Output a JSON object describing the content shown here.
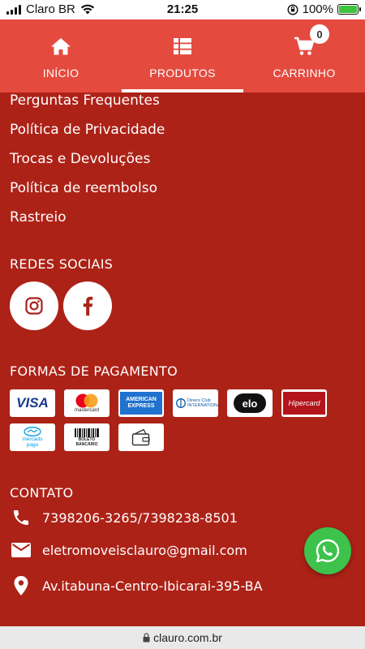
{
  "status_bar": {
    "carrier": "Claro BR",
    "time": "21:25",
    "battery": "100%",
    "battery_level": 1.0
  },
  "nav": {
    "tabs": [
      {
        "label": "INÍCIO",
        "icon": "home-icon",
        "active": false
      },
      {
        "label": "PRODUTOS",
        "icon": "list-icon",
        "active": true
      },
      {
        "label": "CARRINHO",
        "icon": "cart-icon",
        "active": false
      }
    ],
    "cart_count": "0"
  },
  "links": [
    "Perguntas Frequentes",
    "Política de Privacidade",
    "Trocas e Devoluções",
    "Política de reembolso",
    "Rastreio"
  ],
  "social": {
    "title": "REDES SOCIAIS",
    "items": [
      {
        "icon": "instagram-icon"
      },
      {
        "icon": "facebook-icon"
      }
    ]
  },
  "payments": {
    "title": "FORMAS DE PAGAMENTO",
    "items": [
      {
        "label": "VISA",
        "icon": "visa-icon"
      },
      {
        "label": "mastercard",
        "icon": "mastercard-icon"
      },
      {
        "label": "AMERICAN EXPRESS",
        "icon": "amex-icon"
      },
      {
        "label": "Diners Club INTERNATIONAL",
        "icon": "diners-icon"
      },
      {
        "label": "elo",
        "icon": "elo-icon"
      },
      {
        "label": "Hipercard",
        "icon": "hipercard-icon"
      },
      {
        "label": "mercado pago",
        "icon": "mercadopago-icon"
      },
      {
        "label": "BOLETO BANCÁRIO",
        "icon": "boleto-icon"
      },
      {
        "label": "",
        "icon": "wallet-icon"
      }
    ]
  },
  "contact": {
    "title": "CONTATO",
    "phone": "7398206-3265/7398238-8501",
    "email": "eletromoveisclauro@gmail.com",
    "address": "Av.itabuna-Centro-Ibicarai-395-BA"
  },
  "url_bar": {
    "url": "clauro.com.br"
  },
  "colors": {
    "nav_bg": "#e54a3f",
    "page_bg": "#ad2217",
    "whatsapp": "#3dc24c"
  }
}
